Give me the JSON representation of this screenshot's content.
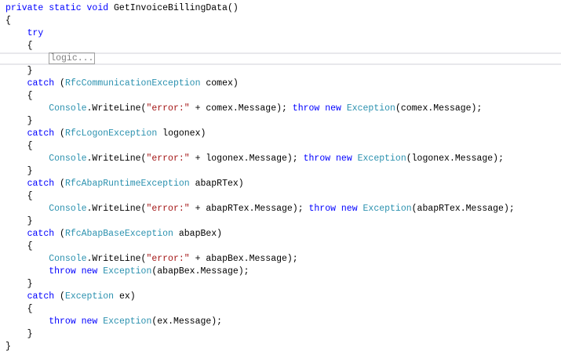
{
  "colors": {
    "keyword": "#0000ff",
    "type": "#2b91af",
    "string": "#a31515",
    "plain": "#000000"
  },
  "lines": [
    [
      {
        "t": "private static void ",
        "c": "kw"
      },
      {
        "t": "GetInvoiceBillingData()",
        "c": "pl"
      }
    ],
    [
      {
        "t": "{",
        "c": "pl"
      }
    ],
    [
      {
        "t": "    ",
        "c": "pl"
      },
      {
        "t": "try",
        "c": "kw"
      }
    ],
    [
      {
        "t": "    {",
        "c": "pl"
      }
    ],
    [
      {
        "t": "        ",
        "c": "pl"
      },
      {
        "t": "logic...",
        "c": "collapsed"
      }
    ],
    [
      {
        "t": "    }",
        "c": "pl"
      }
    ],
    [
      {
        "t": "    ",
        "c": "pl"
      },
      {
        "t": "catch",
        "c": "kw"
      },
      {
        "t": " (",
        "c": "pl"
      },
      {
        "t": "RfcCommunicationException",
        "c": "ty"
      },
      {
        "t": " comex)",
        "c": "pl"
      }
    ],
    [
      {
        "t": "    {",
        "c": "pl"
      }
    ],
    [
      {
        "t": "        ",
        "c": "pl"
      },
      {
        "t": "Console",
        "c": "ty"
      },
      {
        "t": ".WriteLine(",
        "c": "pl"
      },
      {
        "t": "\"error:\"",
        "c": "st"
      },
      {
        "t": " + comex.Message); ",
        "c": "pl"
      },
      {
        "t": "throw new ",
        "c": "kw"
      },
      {
        "t": "Exception",
        "c": "ty"
      },
      {
        "t": "(comex.Message);",
        "c": "pl"
      }
    ],
    [
      {
        "t": "    }",
        "c": "pl"
      }
    ],
    [
      {
        "t": "    ",
        "c": "pl"
      },
      {
        "t": "catch",
        "c": "kw"
      },
      {
        "t": " (",
        "c": "pl"
      },
      {
        "t": "RfcLogonException",
        "c": "ty"
      },
      {
        "t": " logonex)",
        "c": "pl"
      }
    ],
    [
      {
        "t": "    {",
        "c": "pl"
      }
    ],
    [
      {
        "t": "        ",
        "c": "pl"
      },
      {
        "t": "Console",
        "c": "ty"
      },
      {
        "t": ".WriteLine(",
        "c": "pl"
      },
      {
        "t": "\"error:\"",
        "c": "st"
      },
      {
        "t": " + logonex.Message); ",
        "c": "pl"
      },
      {
        "t": "throw new ",
        "c": "kw"
      },
      {
        "t": "Exception",
        "c": "ty"
      },
      {
        "t": "(logonex.Message);",
        "c": "pl"
      }
    ],
    [
      {
        "t": "    }",
        "c": "pl"
      }
    ],
    [
      {
        "t": "    ",
        "c": "pl"
      },
      {
        "t": "catch",
        "c": "kw"
      },
      {
        "t": " (",
        "c": "pl"
      },
      {
        "t": "RfcAbapRuntimeException",
        "c": "ty"
      },
      {
        "t": " abapRTex)",
        "c": "pl"
      }
    ],
    [
      {
        "t": "    {",
        "c": "pl"
      }
    ],
    [
      {
        "t": "        ",
        "c": "pl"
      },
      {
        "t": "Console",
        "c": "ty"
      },
      {
        "t": ".WriteLine(",
        "c": "pl"
      },
      {
        "t": "\"error:\"",
        "c": "st"
      },
      {
        "t": " + abapRTex.Message); ",
        "c": "pl"
      },
      {
        "t": "throw new ",
        "c": "kw"
      },
      {
        "t": "Exception",
        "c": "ty"
      },
      {
        "t": "(abapRTex.Message);",
        "c": "pl"
      }
    ],
    [
      {
        "t": "    }",
        "c": "pl"
      }
    ],
    [
      {
        "t": "    ",
        "c": "pl"
      },
      {
        "t": "catch",
        "c": "kw"
      },
      {
        "t": " (",
        "c": "pl"
      },
      {
        "t": "RfcAbapBaseException",
        "c": "ty"
      },
      {
        "t": " abapBex)",
        "c": "pl"
      }
    ],
    [
      {
        "t": "    {",
        "c": "pl"
      }
    ],
    [
      {
        "t": "        ",
        "c": "pl"
      },
      {
        "t": "Console",
        "c": "ty"
      },
      {
        "t": ".WriteLine(",
        "c": "pl"
      },
      {
        "t": "\"error:\"",
        "c": "st"
      },
      {
        "t": " + abapBex.Message);",
        "c": "pl"
      }
    ],
    [
      {
        "t": "        ",
        "c": "pl"
      },
      {
        "t": "throw new ",
        "c": "kw"
      },
      {
        "t": "Exception",
        "c": "ty"
      },
      {
        "t": "(abapBex.Message);",
        "c": "pl"
      }
    ],
    [
      {
        "t": "    }",
        "c": "pl"
      }
    ],
    [
      {
        "t": "    ",
        "c": "pl"
      },
      {
        "t": "catch",
        "c": "kw"
      },
      {
        "t": " (",
        "c": "pl"
      },
      {
        "t": "Exception",
        "c": "ty"
      },
      {
        "t": " ex)",
        "c": "pl"
      }
    ],
    [
      {
        "t": "    {",
        "c": "pl"
      }
    ],
    [
      {
        "t": "        ",
        "c": "pl"
      },
      {
        "t": "throw new ",
        "c": "kw"
      },
      {
        "t": "Exception",
        "c": "ty"
      },
      {
        "t": "(ex.Message);",
        "c": "pl"
      }
    ],
    [
      {
        "t": "    }",
        "c": "pl"
      }
    ],
    [
      {
        "t": "}",
        "c": "pl"
      }
    ]
  ]
}
